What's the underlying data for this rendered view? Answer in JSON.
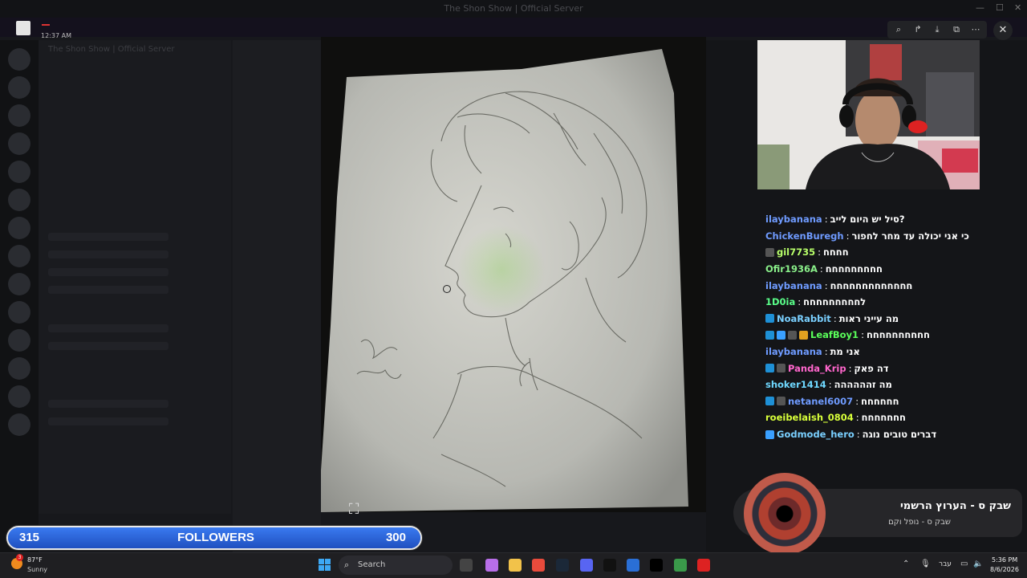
{
  "window": {
    "title": "The Shon Show | Official Server"
  },
  "discord": {
    "time": "12:37 AM",
    "server_name": "The Shon Show | Official Server"
  },
  "viewer": {
    "toolbar": [
      {
        "name": "zoom-in-icon",
        "glyph": "⌕"
      },
      {
        "name": "forward-icon",
        "glyph": "↱"
      },
      {
        "name": "download-icon",
        "glyph": "⤓"
      },
      {
        "name": "open-external-icon",
        "glyph": "⧉"
      },
      {
        "name": "more-icon",
        "glyph": "⋯"
      }
    ],
    "close_glyph": "✕"
  },
  "chat": {
    "messages": [
      {
        "user": "ilaybanana",
        "color": "#6f9bff",
        "text": "סיל יש היום לייב?",
        "badges": []
      },
      {
        "user": "ChickenBuregh",
        "color": "#6f9bff",
        "text": "כי אני יכולה עד מחר לחפור",
        "badges": []
      },
      {
        "user": "gil7735",
        "color": "#b8ff6a",
        "text": "חחחח",
        "badges": [
          "#555"
        ]
      },
      {
        "user": "Ofir1936A",
        "color": "#8af08a",
        "text": "חחחחחחחחח",
        "badges": []
      },
      {
        "user": "ilaybanana",
        "color": "#6f9bff",
        "text": "חחחחחחחחחחחחח",
        "badges": []
      },
      {
        "user": "1D0ia",
        "color": "#5aff8a",
        "text": "לחחחחחחחחח",
        "badges": []
      },
      {
        "user": "NoaRabbit",
        "color": "#7ad0ff",
        "text": "מה עייני ראות",
        "badges": [
          "#1e90d6"
        ]
      },
      {
        "user": "LeafBoy1",
        "color": "#5aff5a",
        "text": "חחחחחחחחחח",
        "badges": [
          "#1e90d6",
          "#3aa0ff",
          "#555",
          "#e0a020"
        ]
      },
      {
        "user": "ilaybanana",
        "color": "#6f9bff",
        "text": "אני מת",
        "badges": []
      },
      {
        "user": "Panda_Krip",
        "color": "#ff66cc",
        "text": "דה פאק",
        "badges": [
          "#1e90d6",
          "#555"
        ]
      },
      {
        "user": "shoker1414",
        "color": "#6fd8ff",
        "text": "מה זהההההה",
        "badges": []
      },
      {
        "user": "netanel6007",
        "color": "#6f9bff",
        "text": "חחחחחח",
        "badges": [
          "#1e90d6",
          "#555"
        ]
      },
      {
        "user": "roeibelaish_0804",
        "color": "#d8ff3a",
        "text": "חחחחחחח",
        "badges": []
      },
      {
        "user": "Godmode_hero",
        "color": "#7ad0ff",
        "text": "דברים טובים נוגה",
        "badges": [
          "#3aa0ff"
        ]
      }
    ]
  },
  "now_playing": {
    "title": "שבק ס - הערוץ הרשמי",
    "artist": "שבק ס - נופל וקם"
  },
  "followers": {
    "current": "315",
    "label": "FOLLOWERS",
    "goal": "300",
    "progress": 1.0
  },
  "taskbar": {
    "weather_temp": "87°F",
    "weather_desc": "Sunny",
    "weather_badge": "3",
    "search_label": "Search",
    "apps": [
      {
        "name": "task-view-icon",
        "color": "#444"
      },
      {
        "name": "copilot-icon",
        "color": "#b86ee8"
      },
      {
        "name": "file-explorer-icon",
        "color": "#f2c24a"
      },
      {
        "name": "chrome-icon",
        "color": "#e94b3c"
      },
      {
        "name": "steam-icon",
        "color": "#1b2838"
      },
      {
        "name": "discord-icon",
        "color": "#5865f2"
      },
      {
        "name": "epic-games-icon",
        "color": "#111"
      },
      {
        "name": "photoshop-icon",
        "color": "#2a6fd6"
      },
      {
        "name": "capcut-icon",
        "color": "#000"
      },
      {
        "name": "chrome-alt-icon",
        "color": "#3a9a4a"
      },
      {
        "name": "roblox-icon",
        "color": "#d22"
      }
    ],
    "tray_lang": "עבר",
    "clock_time": "5:36 PM",
    "clock_date": "8/6/2026"
  }
}
